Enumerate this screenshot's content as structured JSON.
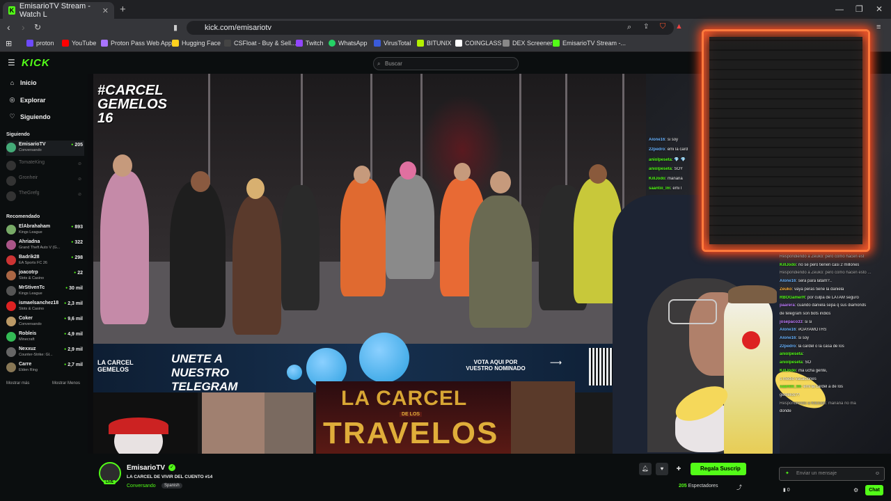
{
  "browser": {
    "tab_title": "EmisarioTV Stream - Watch L",
    "url": "kick.com/emisariotv",
    "bookmarks": [
      "proton",
      "YouTube",
      "Proton Pass Web App",
      "Hugging Face",
      "CSFloat - Buy & Sell...",
      "Twitch",
      "WhatsApp",
      "VirusTotal",
      "BITUNIX",
      "COINGLASS",
      "DEX Screener",
      "EmisarioTV Stream -..."
    ]
  },
  "kick": {
    "logo": "KICK",
    "search_placeholder": "Buscar",
    "nav": [
      "Inicio",
      "Explorar",
      "Siguiendo"
    ],
    "following_header": "Siguiendo",
    "following": [
      {
        "name": "EmisarioTV",
        "category": "Conversando",
        "viewers": "205",
        "live": true
      },
      {
        "name": "TomateKing",
        "category": "",
        "viewers": "",
        "live": false
      },
      {
        "name": "Gronheir",
        "category": "",
        "viewers": "",
        "live": false
      },
      {
        "name": "TheGrefg",
        "category": "",
        "viewers": "",
        "live": false
      }
    ],
    "recommended_header": "Recomendado",
    "recommended": [
      {
        "name": "ElAbrahaham",
        "category": "Kings League",
        "viewers": "893"
      },
      {
        "name": "Ahriadna",
        "category": "Grand Theft Auto V (G...",
        "viewers": "322"
      },
      {
        "name": "Badrik28",
        "category": "EA Sports FC 26",
        "viewers": "298"
      },
      {
        "name": "joacotrp",
        "category": "Slots & Casino",
        "viewers": "22"
      },
      {
        "name": "MrStivenTc",
        "category": "Kings League",
        "viewers": "30 mil"
      },
      {
        "name": "ismaelsanchez18",
        "category": "Slots & Casino",
        "viewers": "2,3 mil"
      },
      {
        "name": "Coker",
        "category": "Conversando",
        "viewers": "9,6 mil"
      },
      {
        "name": "Robleis",
        "category": "Minecraft",
        "viewers": "4,9 mil"
      },
      {
        "name": "Nexxuz",
        "category": "Counter-Strike: Gl...",
        "viewers": "2,9 mil"
      },
      {
        "name": "Carre",
        "category": "Elden Ring",
        "viewers": "2,7 mil"
      }
    ],
    "show_more": "Mostrar más",
    "show_less": "Mostrar Menos"
  },
  "stream": {
    "overlay_title": "#CARCEL GEMELOS 16",
    "banner_left": "LA CARCEL GEMELOS",
    "banner_telegram": "UNETE A NUESTRO TELEGRAM",
    "banner_vote": "VOTA AQUI POR VUESTRO NOMINADO",
    "travelos_top": "LA CARCEL",
    "travelos_mid": "DE LOS",
    "travelos_bottom": "TRAVELOS",
    "channel": "EmisarioTV",
    "title": "LA CARCEL DE VIVIR DEL CUENTO #14",
    "category": "Conversando",
    "language": "Spanish",
    "viewers": "205",
    "viewers_label": "Espectadores",
    "subscribe_label": "Regala Suscrip",
    "live_badge": "LIVE"
  },
  "chat_overlay_left": [
    {
      "user": "Alone16",
      "text": "si soy",
      "color": "#6ab4ff"
    },
    {
      "user": "22pedro",
      "text": "emi la card",
      "color": "#6ab4ff"
    },
    {
      "user": "aniolpeseta",
      "text": "💎 💎",
      "color": "#53fc18"
    },
    {
      "user": "aniolpeseta",
      "text": "SOY",
      "color": "#53fc18"
    },
    {
      "user": "KillJodo",
      "text": "mañana",
      "color": "#53fc18"
    },
    {
      "user": "saantiii_lm",
      "text": "emi l",
      "color": "#53fc18"
    }
  ],
  "chat_overlay_right": [
    {
      "user": "",
      "text": "Respondiendo a Zeuko: pero como hacen est",
      "color": "#aaa"
    },
    {
      "user": "KillJodo",
      "text": "no se pero tienen casi 2 millones",
      "color": "#53fc18"
    },
    {
      "user": "",
      "text": "Respondiendo a Zeuko: pero como hacen esto ...",
      "color": "#aaa"
    },
    {
      "user": "Alone16",
      "text": "sera para latam?..",
      "color": "#6ab4ff"
    },
    {
      "user": "Zeuko",
      "text": "vaya peras tiene la daniela",
      "color": "#ffb23c"
    },
    {
      "user": "RBOGamerR",
      "text": "por culpa de LATAM seguro",
      "color": "#53fc18"
    },
    {
      "user": "paarera",
      "text": "cuando daniela sepa q sus diamonds",
      "color": "#c07cff"
    },
    {
      "user": "",
      "text": "de telegram son bots indios",
      "color": "#f2f2f2"
    },
    {
      "user": "josepaco33",
      "text": "si si",
      "color": "#c07cff"
    },
    {
      "user": "Alone16",
      "text": "#OAYAMOTHS",
      "color": "#6ab4ff"
    },
    {
      "user": "Alone16",
      "text": "si soy",
      "color": "#6ab4ff"
    },
    {
      "user": "22pedro",
      "text": "la cardel o la casa de los",
      "color": "#6ab4ff"
    },
    {
      "user": "aniolpeseta",
      "text": "",
      "color": "#53fc18"
    },
    {
      "user": "aniolpeseta",
      "text": "SO",
      "color": "#53fc18"
    },
    {
      "user": "KillJodo",
      "text": "ma        ucha gente,",
      "color": "#53fc18"
    },
    {
      "user": "",
      "text": "s medio vacaciones",
      "color": "#f2f2f2"
    },
    {
      "user": "saantiii_lm",
      "text": "emi la cardel        a de los",
      "color": "#53fc18"
    },
    {
      "user": "",
      "text": "gemelos??",
      "color": "#f2f2f2"
    },
    {
      "user": "",
      "text": "Respondiendo a KillJodo: mañana no ma",
      "color": "#aaa"
    },
    {
      "user": "",
      "text": "donde",
      "color": "#f2f2f2"
    }
  ],
  "chat": {
    "placeholder": "Enviar un mensaje",
    "send_label": "Chat",
    "points": "0"
  },
  "colors": {
    "accent": "#53fc18",
    "frame": "#ff7a3c"
  }
}
